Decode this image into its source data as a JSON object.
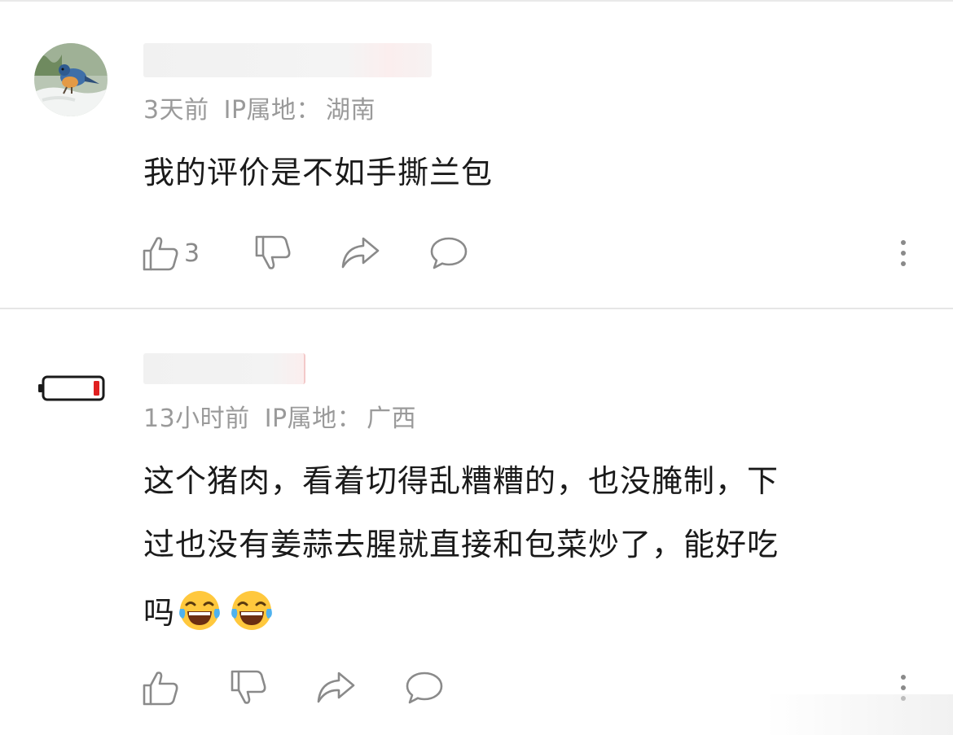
{
  "comments": [
    {
      "avatar_icon": "bird-photo-avatar",
      "name_blurred": true,
      "time": "3天前",
      "ip_label": "IP属地：",
      "ip_region": "湖南",
      "text_lines": [
        "我的评价是不如手撕兰包"
      ],
      "like_count": "3"
    },
    {
      "avatar_icon": "low-battery-avatar",
      "name_blurred": true,
      "time": "13小时前",
      "ip_label": "IP属地：",
      "ip_region": "广西",
      "text_lines": [
        "这个猪肉，看着切得乱糟糟的，也没腌制，下",
        "过也没有姜蒜去腥就直接和包菜炒了，能好吃",
        "吗"
      ],
      "emojis": [
        "laughing-tears-emoji",
        "laughing-tears-emoji"
      ],
      "like_count": ""
    }
  ],
  "colors": {
    "meta_text": "#9a9a9a",
    "body_text": "#1a1a1a",
    "icon_stroke": "#8a8a8a",
    "battery_red": "#e02020"
  }
}
